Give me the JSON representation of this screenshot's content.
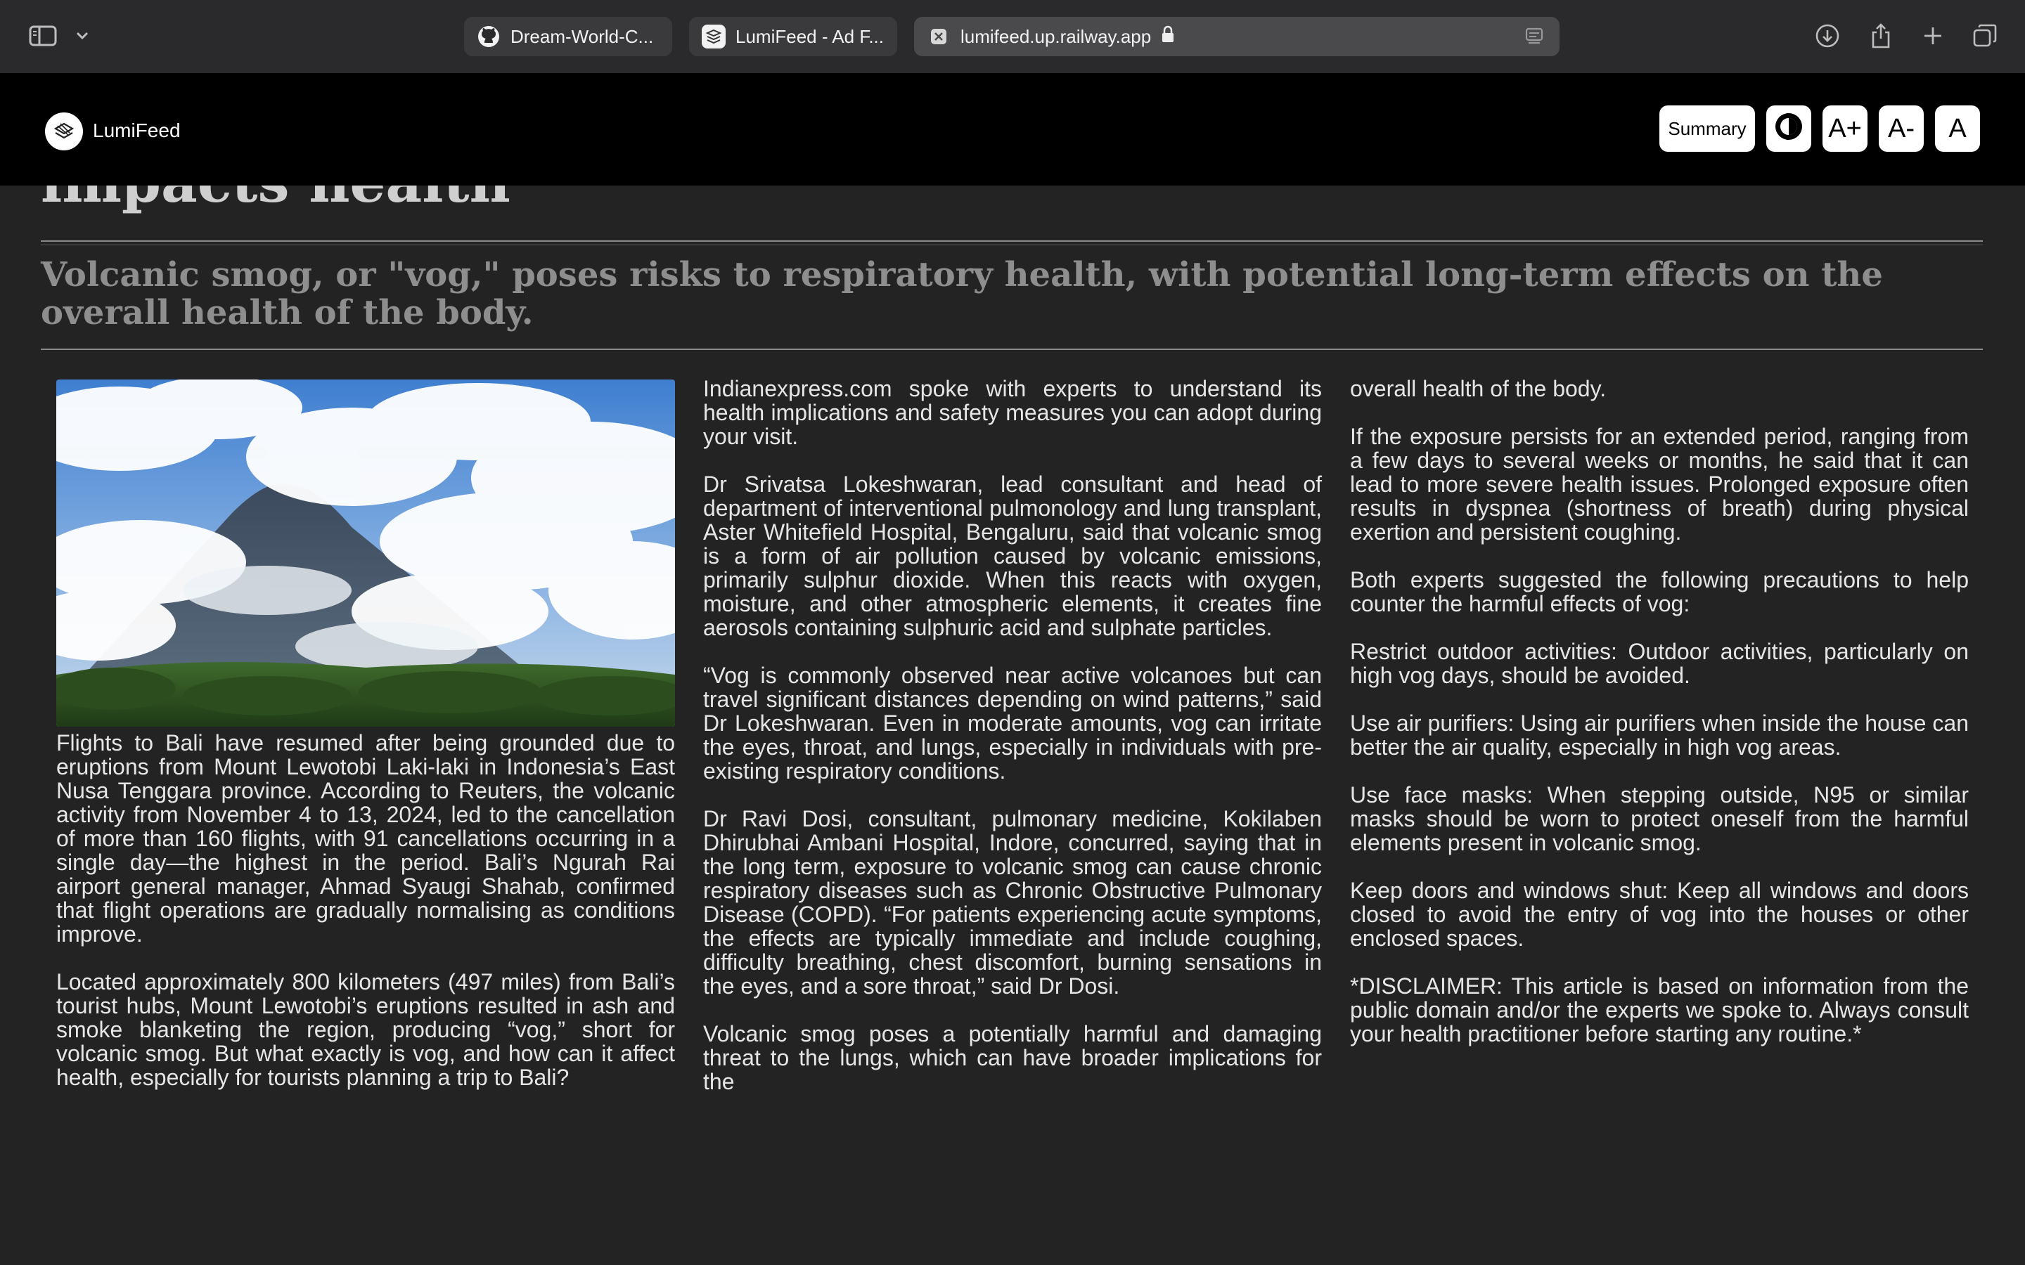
{
  "browser": {
    "tabs": [
      {
        "label": "Dream-World-C...",
        "icon": "github-icon"
      },
      {
        "label": "LumiFeed - Ad F...",
        "icon": "lumifeed-favicon"
      },
      {
        "label": "lumifeed.up.railway.app",
        "icon": "close-tab-icon",
        "active": true
      }
    ]
  },
  "header": {
    "brand": "LumiFeed",
    "summary_label": "Summary",
    "font_increase_label": "A+",
    "font_decrease_label": "A-",
    "font_reset_label": "A"
  },
  "article": {
    "headline_visible": "impacts health",
    "subheadline": "Volcanic smog, or \"vog,\" poses risks to respiratory health, with potential long-term effects on the overall health of the body.",
    "paragraphs": [
      "Flights to Bali have resumed after being grounded due to eruptions from Mount Lewotobi Laki-laki in Indonesia’s East Nusa Tenggara province. According to Reuters, the volcanic activity from November 4 to 13, 2024, led to the cancellation of more than 160 flights, with 91 cancellations occurring in a single day—the highest in the period. Bali’s Ngurah Rai airport general manager, Ahmad Syaugi Shahab, confirmed that flight operations are gradually normalising as conditions improve.",
      "Located approximately 800 kilometers (497 miles) from Bali’s tourist hubs, Mount Lewotobi’s eruptions resulted in ash and smoke blanketing the region, producing “vog,” short for volcanic smog. But what exactly is vog, and how can it affect health, especially for tourists planning a trip to Bali?",
      "Indianexpress.com spoke with experts to understand its health implications and safety measures you can adopt during your visit.",
      "Dr Srivatsa Lokeshwaran, lead consultant and head of department of interventional pulmonology and lung transplant, Aster Whitefield Hospital, Bengaluru, said that volcanic smog is a form of air pollution caused by volcanic emissions, primarily sulphur dioxide. When this reacts with oxygen, moisture, and other atmospheric elements, it creates fine aerosols containing sulphuric acid and sulphate particles.",
      "“Vog is commonly observed near active volcanoes but can travel significant distances depending on wind patterns,” said Dr Lokeshwaran. Even in moderate amounts, vog can irritate the eyes, throat, and lungs, especially in individuals with pre-existing respiratory conditions.",
      "Dr Ravi Dosi, consultant, pulmonary medicine, Kokilaben Dhirubhai Ambani Hospital, Indore, concurred, saying that in the long term, exposure to volcanic smog can cause chronic respiratory diseases such as Chronic Obstructive Pulmonary Disease (COPD). “For patients experiencing acute symptoms, the effects are typically immediate and include coughing, difficulty breathing, chest discomfort, burning sensations in the eyes, and a sore throat,” said Dr Dosi.",
      "Volcanic smog poses a potentially harmful and damaging threat to the lungs, which can have broader implications for the",
      "overall health of the body.",
      "If the exposure persists for an extended period, ranging from a few days to several weeks or months, he said that it can lead to more severe health issues. Prolonged exposure often results in dyspnea (shortness of breath) during physical exertion and persistent coughing.",
      "Both experts suggested the following precautions to help counter the harmful effects of vog:",
      "Restrict outdoor activities: Outdoor activities, particularly on high vog days, should be avoided.",
      "Use air purifiers: Using air purifiers when inside the house can better the air quality, especially in high vog areas.",
      "Use face masks: When stepping outside, N95 or similar masks should be worn to protect oneself from the harmful elements present in volcanic smog.",
      "Keep doors and windows shut: Keep all windows and doors closed to avoid the entry of vog into the houses or other enclosed spaces.",
      "*DISCLAIMER: This article is based on information from the public domain and/or the experts we spoke to. Always consult your health practitioner before starting any routine.*"
    ]
  },
  "colors": {
    "page_bg": "#232323",
    "header_bg": "#000000",
    "chrome_bg": "#2a2a2c"
  }
}
